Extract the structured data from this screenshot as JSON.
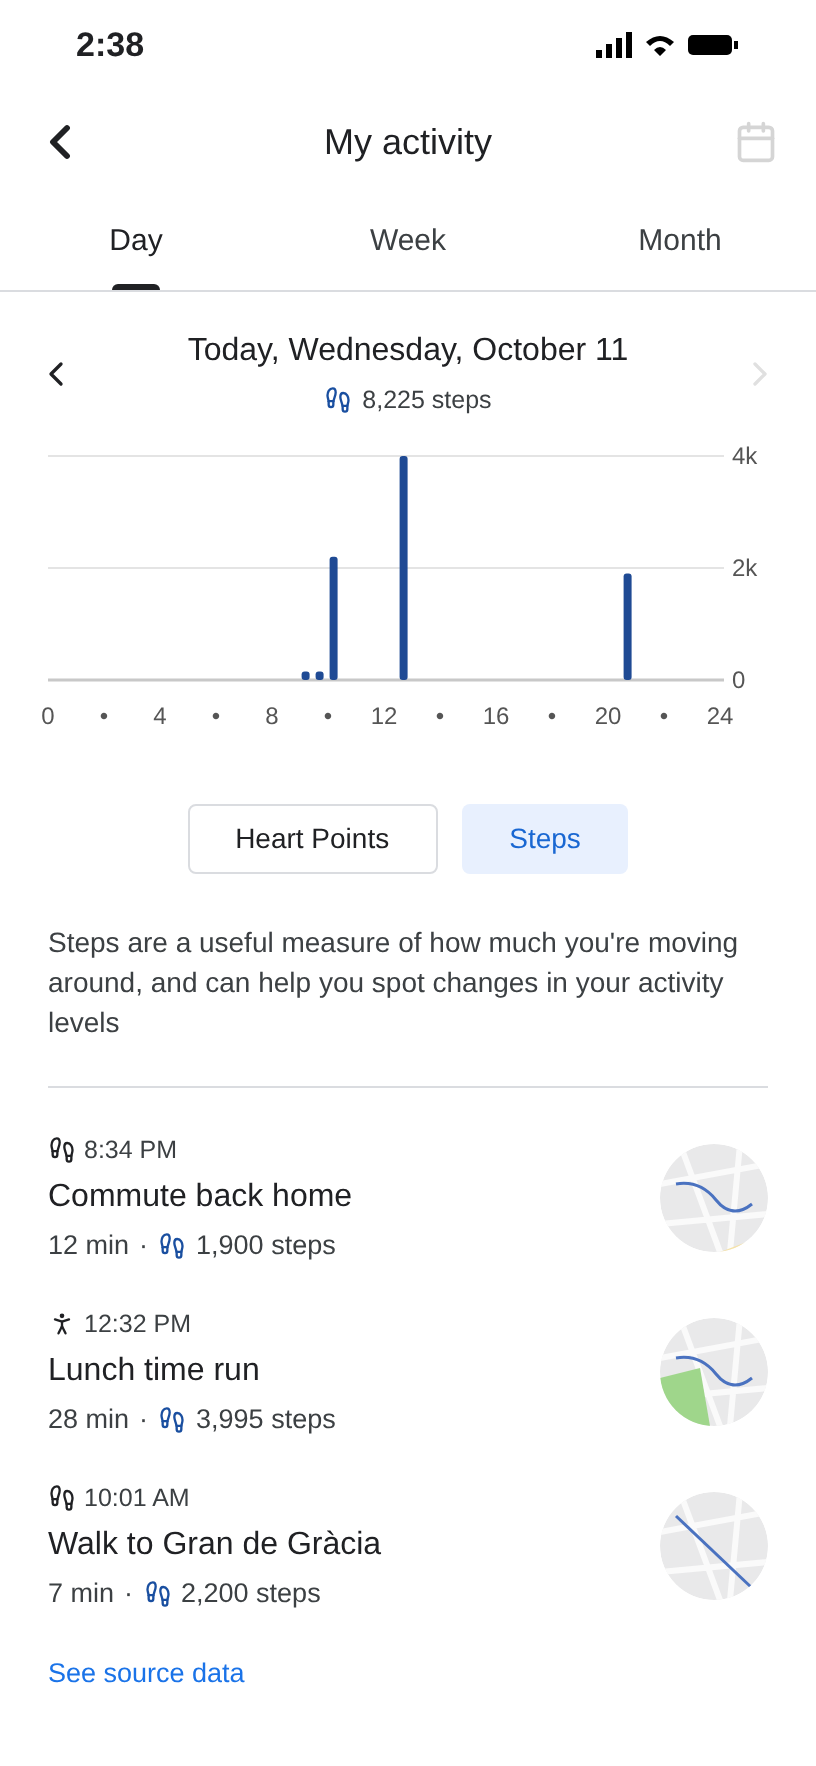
{
  "status_bar": {
    "time": "2:38"
  },
  "header": {
    "title": "My activity"
  },
  "tabs": [
    {
      "label": "Day",
      "selected": true
    },
    {
      "label": "Week",
      "selected": false
    },
    {
      "label": "Month",
      "selected": false
    }
  ],
  "day": {
    "title": "Today, Wednesday, October 11",
    "steps": "8,225 steps"
  },
  "chart_data": {
    "type": "bar",
    "x": [
      9.2,
      9.7,
      10.2,
      12.7,
      20.7
    ],
    "values": [
      150,
      150,
      2200,
      4000,
      1900
    ],
    "xlim": [
      0,
      24
    ],
    "ylim": [
      0,
      4000
    ],
    "xticks": [
      0,
      {
        "value": 2,
        "label": "•"
      },
      4,
      {
        "value": 6,
        "label": "•"
      },
      8,
      {
        "value": 10,
        "label": "•"
      },
      12,
      {
        "value": 14,
        "label": "•"
      },
      16,
      {
        "value": 18,
        "label": "•"
      },
      20,
      {
        "value": 22,
        "label": "•"
      },
      24
    ],
    "yticks": [
      {
        "value": 0,
        "label": "0"
      },
      {
        "value": 2000,
        "label": "2k"
      },
      {
        "value": 4000,
        "label": "4k"
      }
    ]
  },
  "metric_toggle": [
    {
      "label": "Heart Points",
      "selected": false
    },
    {
      "label": "Steps",
      "selected": true
    }
  ],
  "description": "Steps are a useful measure of how much you're moving around, and can help you spot changes in your activity levels",
  "activities": [
    {
      "kind": "walk",
      "time": "8:34 PM",
      "title": "Commute back home",
      "duration": "12 min",
      "separator": "·",
      "steps": "1,900 steps"
    },
    {
      "kind": "run",
      "time": "12:32 PM",
      "title": "Lunch time run",
      "duration": "28 min",
      "separator": "·",
      "steps": "3,995 steps"
    },
    {
      "kind": "walk",
      "time": "10:01 AM",
      "title": "Walk to Gran de Gràcia",
      "duration": "7 min",
      "separator": "·",
      "steps": "2,200 steps"
    }
  ],
  "link": "See source data"
}
